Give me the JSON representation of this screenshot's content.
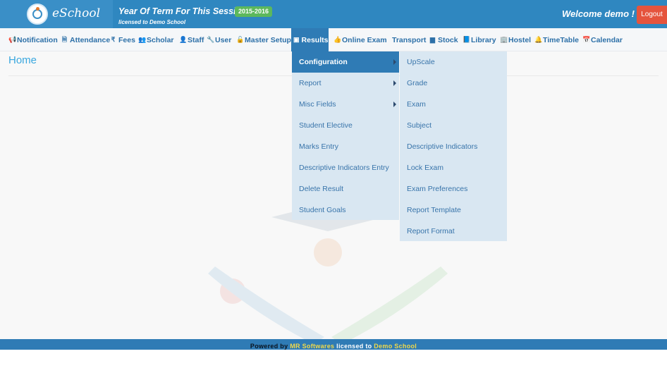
{
  "header": {
    "app_name": "eSchool",
    "session_title": "Year Of Term For This Session :-",
    "session_value": "2015-2016",
    "license_text": "licensed to Demo School",
    "welcome_text": "Welcome demo !",
    "logout_label": "Logout"
  },
  "nav": {
    "items": [
      {
        "label": "Notification",
        "icon": "bullhorn-icon",
        "glyph": "📢"
      },
      {
        "label": "Attendance",
        "icon": "file-icon",
        "glyph": "🗎"
      },
      {
        "label": "Fees",
        "icon": "rupee-icon",
        "glyph": "₹"
      },
      {
        "label": "Scholar",
        "icon": "users-icon",
        "glyph": "👥"
      },
      {
        "label": "Staff",
        "icon": "user-icon",
        "glyph": "👤"
      },
      {
        "label": "User",
        "icon": "wrench-icon",
        "glyph": "🔧"
      },
      {
        "label": "Master Setup",
        "icon": "unlock-icon",
        "glyph": "🔓"
      },
      {
        "label": "Results",
        "icon": "id-card-icon",
        "glyph": "▣"
      },
      {
        "label": "Online Exam",
        "icon": "thumbs-up-icon",
        "glyph": "👍"
      },
      {
        "label": "Transport",
        "icon": "bus-icon",
        "glyph": ""
      },
      {
        "label": "Stock",
        "icon": "folder-icon",
        "glyph": "▆"
      },
      {
        "label": "Library",
        "icon": "book-icon",
        "glyph": "📘"
      },
      {
        "label": "Hostel",
        "icon": "building-icon",
        "glyph": "🏢"
      },
      {
        "label": "TimeTable",
        "icon": "bell-icon",
        "glyph": "🔔"
      },
      {
        "label": "Calendar",
        "icon": "calendar-icon",
        "glyph": "📅"
      }
    ],
    "active": "Results"
  },
  "page": {
    "title": "Home"
  },
  "results_menu": {
    "items": [
      {
        "label": "Configuration",
        "submenu": true,
        "highlighted": true
      },
      {
        "label": "Report",
        "submenu": true,
        "highlighted": false
      },
      {
        "label": "Misc Fields",
        "submenu": true,
        "highlighted": false
      },
      {
        "label": "Student Elective",
        "submenu": false,
        "highlighted": false
      },
      {
        "label": "Marks Entry",
        "submenu": false,
        "highlighted": false
      },
      {
        "label": "Descriptive Indicators Entry",
        "submenu": false,
        "highlighted": false
      },
      {
        "label": "Delete Result",
        "submenu": false,
        "highlighted": false
      },
      {
        "label": "Student Goals",
        "submenu": false,
        "highlighted": false
      }
    ]
  },
  "configuration_menu": {
    "items": [
      {
        "label": "UpScale"
      },
      {
        "label": "Grade"
      },
      {
        "label": "Exam"
      },
      {
        "label": "Subject"
      },
      {
        "label": "Descriptive Indicators"
      },
      {
        "label": "Lock Exam"
      },
      {
        "label": "Exam Preferences"
      },
      {
        "label": "Report Template"
      },
      {
        "label": "Report Format"
      }
    ]
  },
  "footer": {
    "prefix": "Powered by",
    "brand": "MR Softwares",
    "middle": "licensed to",
    "school": "Demo School"
  },
  "colors": {
    "header_bg": "#2f87c0",
    "nav_active": "#2f7bb5",
    "menu_bg": "#d9e7f2",
    "logout_bg": "#e5543d",
    "session_badge": "#5cb85c"
  }
}
